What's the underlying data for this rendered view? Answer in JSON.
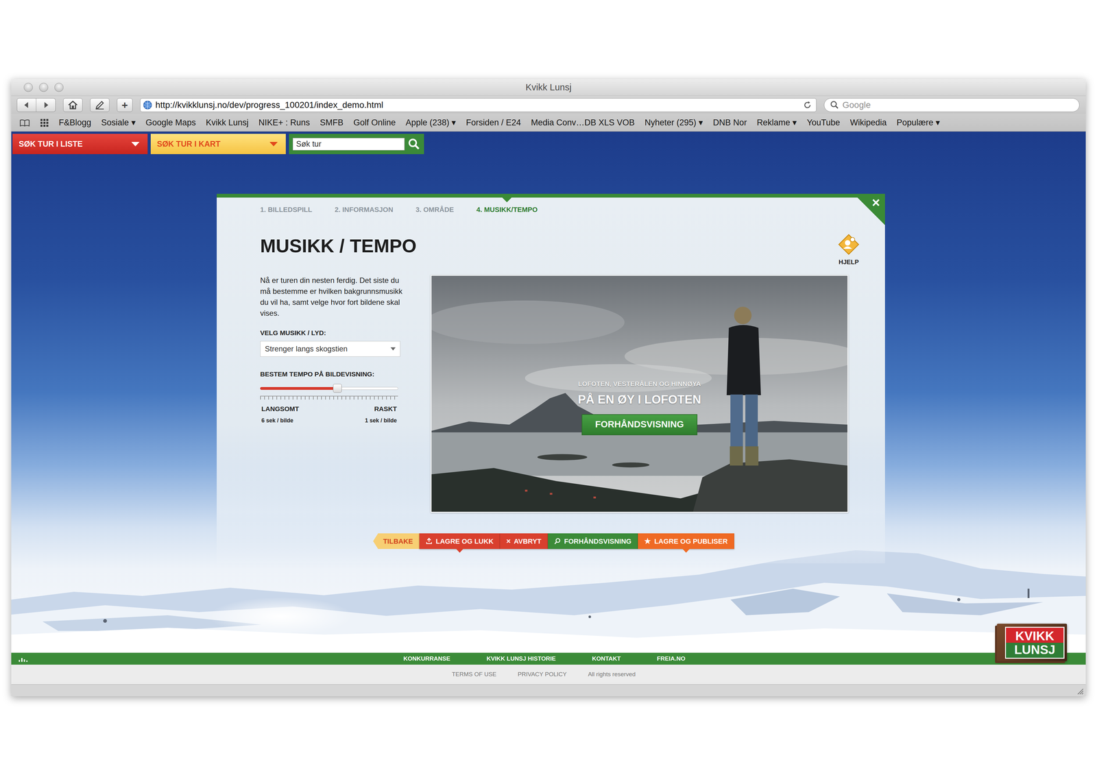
{
  "window": {
    "title": "Kvikk Lunsj"
  },
  "toolbar": {
    "new_tab": "+",
    "url": "http://kvikklunsj.no/dev/progress_100201/index_demo.html",
    "search": {
      "placeholder": "Google"
    }
  },
  "bookmarks": [
    "F&Blogg",
    "Sosiale ▾",
    "Google Maps",
    "Kvikk Lunsj",
    "NIKE+ : Runs",
    "SMFB",
    "Golf Online",
    "Apple (238) ▾",
    "Forsiden / E24",
    "Media Conv…DB XLS VOB",
    "Nyheter (295) ▾",
    "DNB Nor",
    "Reklame ▾",
    "YouTube",
    "Wikipedia",
    "Populære ▾"
  ],
  "site_nav": {
    "menus": [
      {
        "label": "SØK TUR I LISTE",
        "kind": "list"
      },
      {
        "label": "SØK TUR I KART",
        "kind": "map"
      }
    ],
    "search": {
      "placeholder": "Søk tur"
    }
  },
  "wizard": {
    "close": "×",
    "steps": [
      {
        "label": "1. BILLEDSPILL",
        "selected": false
      },
      {
        "label": "2. INFORMASJON",
        "selected": false
      },
      {
        "label": "3. OMRÅDE",
        "selected": false
      },
      {
        "label": "4. MUSIKK/TEMPO",
        "selected": true
      }
    ],
    "title": "MUSIKK / TEMPO",
    "help": "HJELP",
    "intro": "Nå er turen din nesten ferdig. Det siste du må bestemme er hvilken bakgrunnsmusikk du vil ha, samt velge hvor fort bildene skal vises.",
    "music": {
      "label": "VELG MUSIKK / LYD:",
      "value": "Strenger langs skogstien"
    },
    "tempo": {
      "label": "BESTEM TEMPO PÅ BILDEVISNING:",
      "level": 0.56,
      "min_label": "LANGSOMT",
      "max_label": "RASKT",
      "min_reading": "6 sek / bilde",
      "max_reading": "1 sek / bilde"
    },
    "preview": {
      "region": "LOFOTEN, VESTERÅLEN OG HINNØYA",
      "title": "PÅ EN ØY I LOFOTEN",
      "button": "FORHÅNDSVISNING"
    },
    "actions": [
      {
        "label": "TILBAKE",
        "kind": "back"
      },
      {
        "label": "LAGRE OG LUKK",
        "kind": "save"
      },
      {
        "label": "AVBRYT",
        "kind": "cancel",
        "icon": "×"
      },
      {
        "label": "FORHÅNDSVISNING",
        "kind": "preview"
      },
      {
        "label": "LAGRE OG PUBLISER",
        "kind": "publish",
        "icon": "★"
      }
    ]
  },
  "footer": {
    "links": [
      "KONKURRANSE",
      "KVIKK LUNSJ HISTORIE",
      "KONTAKT",
      "FREIA.NO"
    ],
    "legal": [
      "TERMS OF USE",
      "PRIVACY POLICY",
      "All rights reserved"
    ]
  },
  "logo": {
    "top": "KVIKK",
    "bottom": "LUNSJ"
  }
}
